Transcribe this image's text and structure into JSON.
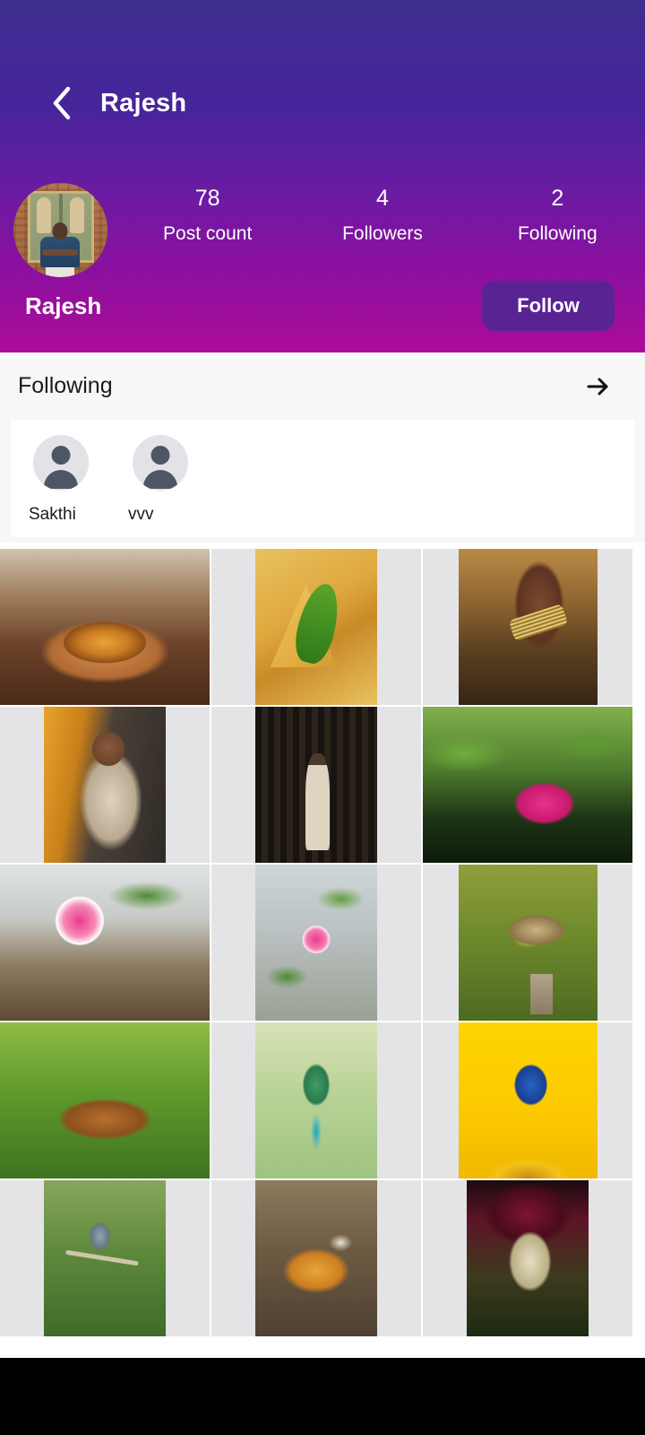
{
  "appbar": {
    "back_icon": "chevron-left-icon",
    "title": "Rajesh"
  },
  "profile": {
    "name": "Rajesh",
    "avatar_alt": "profile-photo",
    "stats": [
      {
        "value": "78",
        "label": "Post count"
      },
      {
        "value": "4",
        "label": "Followers"
      },
      {
        "value": "2",
        "label": "Following"
      }
    ],
    "follow_button": "Follow"
  },
  "following_section": {
    "title": "Following",
    "arrow_icon": "arrow-right-icon",
    "users": [
      {
        "name": "Sakthi",
        "avatar": "person-placeholder-icon"
      },
      {
        "name": "vvv",
        "avatar": "person-placeholder-icon"
      }
    ]
  },
  "photo_grid": {
    "columns": 3,
    "items": [
      {
        "alt": "chole-bowl-street-food",
        "shape": "wide",
        "style": "p-chole"
      },
      {
        "alt": "samosa-with-green-chilli",
        "shape": "tall",
        "style": "p-samosa"
      },
      {
        "alt": "henna-hand-with-bangles",
        "shape": "tall2",
        "style": "p-henna"
      },
      {
        "alt": "bride-portrait-gold-light",
        "shape": "tall",
        "style": "p-bride1"
      },
      {
        "alt": "bride-portrait-dark-backdrop",
        "shape": "tall",
        "style": "p-bride2"
      },
      {
        "alt": "pink-lotus-on-pond",
        "shape": "wide",
        "style": "p-lotus"
      },
      {
        "alt": "pink-adenium-flower",
        "shape": "wide",
        "style": "p-adenium1"
      },
      {
        "alt": "pink-desert-rose-branch",
        "shape": "tall",
        "style": "p-adenium2"
      },
      {
        "alt": "meadowlark-on-post",
        "shape": "tall2",
        "style": "p-meadowlark"
      },
      {
        "alt": "golden-retriever-on-grass",
        "shape": "wide",
        "style": "p-dog"
      },
      {
        "alt": "turquoise-browed-motmot",
        "shape": "tall",
        "style": "p-motmot"
      },
      {
        "alt": "blue-bunting-on-sunflower",
        "shape": "tall2",
        "style": "p-bunting"
      },
      {
        "alt": "drongo-bird-on-branch",
        "shape": "tall",
        "style": "p-drongo"
      },
      {
        "alt": "chicken-biryani-plate",
        "shape": "tall",
        "style": "p-biryani"
      },
      {
        "alt": "girl-portrait-in-field",
        "shape": "tall",
        "style": "p-girl"
      }
    ]
  },
  "colors": {
    "gradient_top": "#3f2f8f",
    "gradient_bottom": "#ab0c98",
    "follow_button_bg": "#5a2394",
    "grid_cell_bg": "#e4e4e6",
    "section_bg": "#f7f7f8",
    "bottom_bar": "#000000"
  }
}
